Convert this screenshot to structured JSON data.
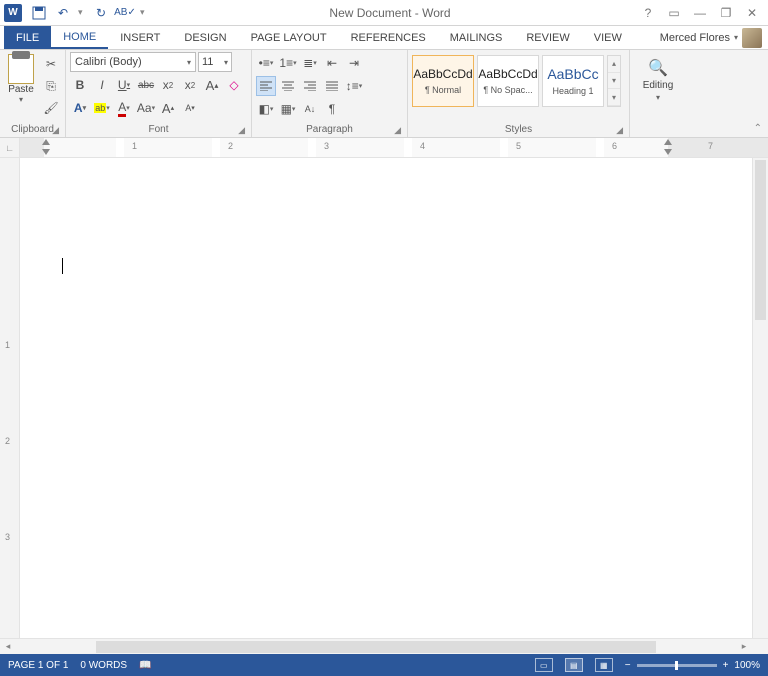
{
  "titlebar": {
    "app_icon": "W",
    "title": "New Document - Word"
  },
  "qat": {
    "save": "save-icon",
    "undo": "undo-icon",
    "redo": "redo-icon",
    "spell": "spellcheck-icon"
  },
  "window_controls": {
    "help": "?",
    "ribbon_opts": "▭",
    "min": "—",
    "restore": "❐",
    "close": "✕"
  },
  "tabs": {
    "file": "FILE",
    "home": "HOME",
    "insert": "INSERT",
    "design": "DESIGN",
    "page_layout": "PAGE LAYOUT",
    "references": "REFERENCES",
    "mailings": "MAILINGS",
    "review": "REVIEW",
    "view": "VIEW"
  },
  "user": {
    "name": "Merced Flores"
  },
  "clipboard": {
    "paste": "Paste",
    "label": "Clipboard"
  },
  "font": {
    "name": "Calibri (Body)",
    "size": "11",
    "bold": "B",
    "italic": "I",
    "underline": "U",
    "strike": "abc",
    "subscript": "x",
    "superscript": "x",
    "grow": "A",
    "shrink": "A",
    "clear": "⌫",
    "texteffects": "A",
    "highlight": "ab",
    "color": "A",
    "changecase": "Aa",
    "label": "Font"
  },
  "paragraph": {
    "label": "Paragraph"
  },
  "styles": {
    "label": "Styles",
    "list": [
      {
        "preview": "AaBbCcDd",
        "name": "¶ Normal"
      },
      {
        "preview": "AaBbCcDd",
        "name": "¶ No Spac..."
      },
      {
        "preview": "AaBbCc",
        "name": "Heading 1"
      }
    ]
  },
  "editing": {
    "label": "Editing"
  },
  "ruler": {
    "marks": [
      "1",
      "2",
      "3",
      "4",
      "5",
      "6",
      "7"
    ]
  },
  "vruler": {
    "marks": [
      "1",
      "2",
      "3"
    ]
  },
  "status": {
    "page": "PAGE 1 OF 1",
    "words": "0 WORDS",
    "zoom": "100%",
    "minus": "−",
    "plus": "+"
  }
}
